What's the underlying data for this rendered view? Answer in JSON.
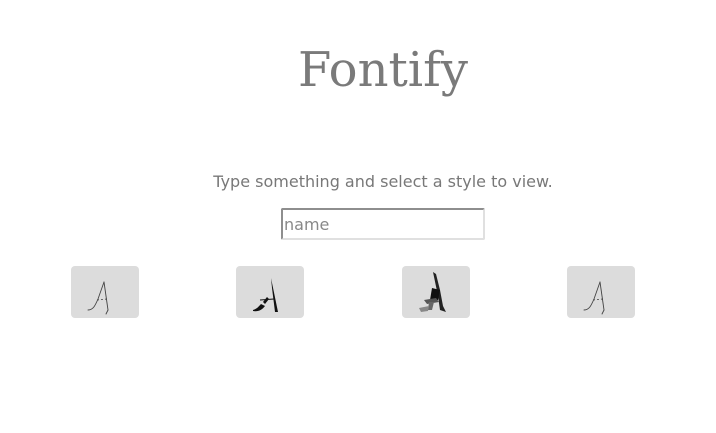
{
  "header": {
    "title": "Fontify"
  },
  "main": {
    "instruction": "Type something and select a style to view.",
    "name_input": {
      "placeholder": "name",
      "value": ""
    },
    "styles": [
      {
        "icon": "calligraphy-a-thin-icon"
      },
      {
        "icon": "calligraphy-a-brush-icon"
      },
      {
        "icon": "calligraphy-a-ink-icon"
      },
      {
        "icon": "calligraphy-a-thin-icon"
      }
    ]
  },
  "colors": {
    "title": "#7a7a7a",
    "text": "#787878",
    "button_bg": "#dcdcdc"
  }
}
